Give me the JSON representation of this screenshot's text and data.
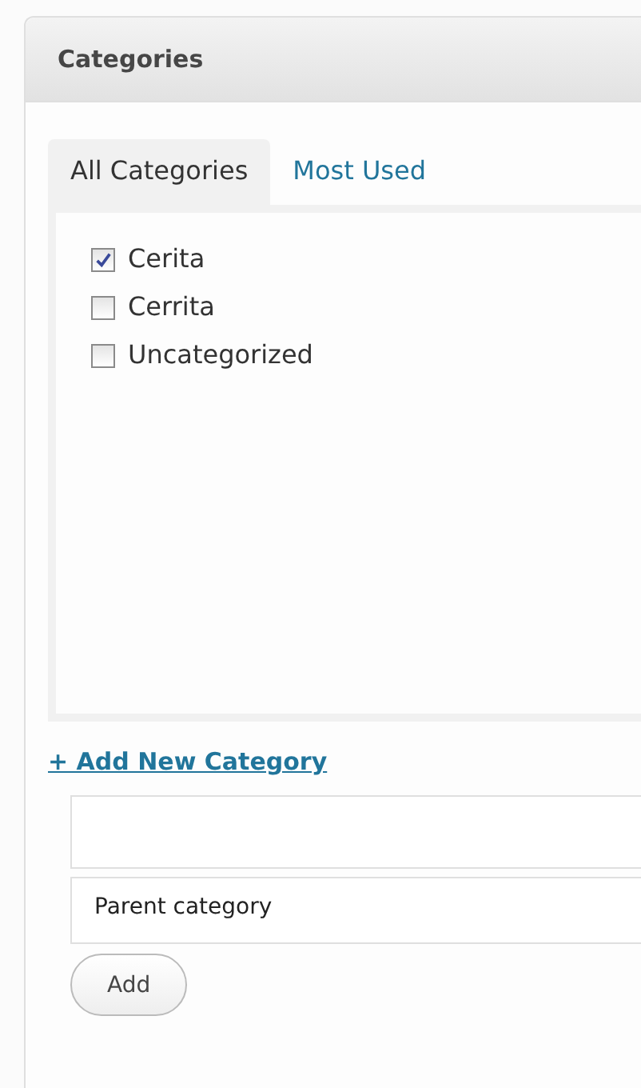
{
  "panel": {
    "title": "Categories"
  },
  "tabs": [
    {
      "label": "All Categories",
      "selected": true
    },
    {
      "label": "Most Used",
      "selected": false
    }
  ],
  "categories": [
    {
      "name": "Cerita",
      "checked": true
    },
    {
      "name": "Cerrita",
      "checked": false
    },
    {
      "name": "Uncategorized",
      "checked": false
    }
  ],
  "add_link": "+ Add New Category",
  "parent_select": {
    "value": "Parent category"
  },
  "add_button": "Add"
}
